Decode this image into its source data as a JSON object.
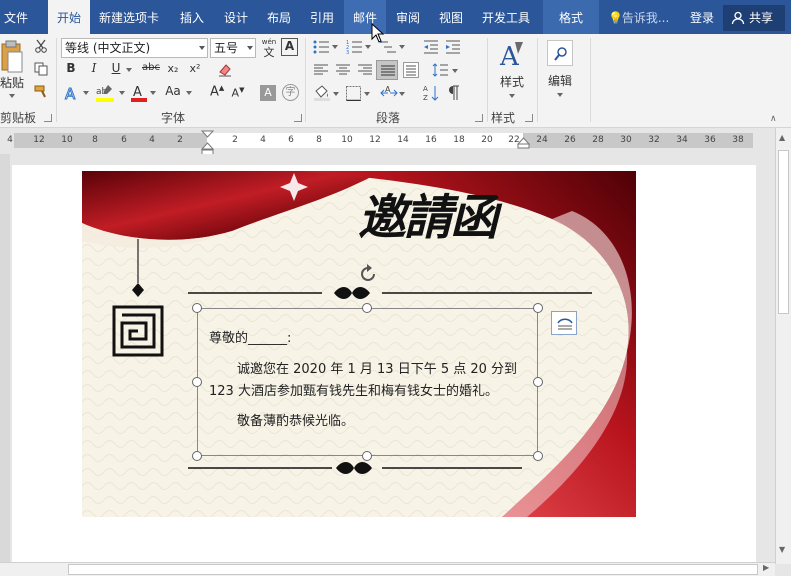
{
  "tabs": [
    {
      "label": "文件"
    },
    {
      "label": "开始"
    },
    {
      "label": "新建选项卡"
    },
    {
      "label": "插入"
    },
    {
      "label": "设计"
    },
    {
      "label": "布局"
    },
    {
      "label": "引用"
    },
    {
      "label": "邮件"
    },
    {
      "label": "审阅"
    },
    {
      "label": "视图"
    },
    {
      "label": "开发工具"
    },
    {
      "label": "格式"
    }
  ],
  "tell_me": "告诉我...",
  "login": "登录",
  "share": "共享",
  "ribbon": {
    "clipboard": {
      "label": "剪贴板",
      "paste": "粘贴"
    },
    "font": {
      "label": "字体",
      "font_name": "等线 (中文正文)",
      "font_size": "五号",
      "wen_glyph": "wén",
      "wen_char": "文",
      "a_box": "A",
      "bold": "B",
      "italic": "I",
      "underline": "U",
      "strike": "abc",
      "subscript": "x₂",
      "superscript": "x²",
      "grow": "A",
      "shrink": "A",
      "case": "Aa"
    },
    "paragraph": {
      "label": "段落"
    },
    "styles": {
      "label": "样式",
      "button": "样式"
    },
    "editing": {
      "button": "编辑"
    }
  },
  "ruler_numbers": [
    "4",
    "12",
    "10",
    "8",
    "6",
    "4",
    "2",
    "2",
    "4",
    "6",
    "8",
    "10",
    "12",
    "14",
    "16",
    "18",
    "20",
    "22",
    "24",
    "26",
    "28",
    "30",
    "32",
    "34",
    "36",
    "38"
  ],
  "invitation": {
    "title": "邀請函",
    "salutation": "尊敬的______:",
    "body_line1": "诚邀您在 2020 年 1 月 13 日下午 5 点 20 分到",
    "body_line2": "123 大酒店参加甄有钱先生和梅有钱女士的婚礼。",
    "closing": "敬备薄酌恭候光临。"
  },
  "colors": {
    "title_bar": "#2b579a",
    "ribbon_bg": "#f3f3f3",
    "curtain_red": "#a3101a",
    "paper": "#f7f3e7"
  }
}
